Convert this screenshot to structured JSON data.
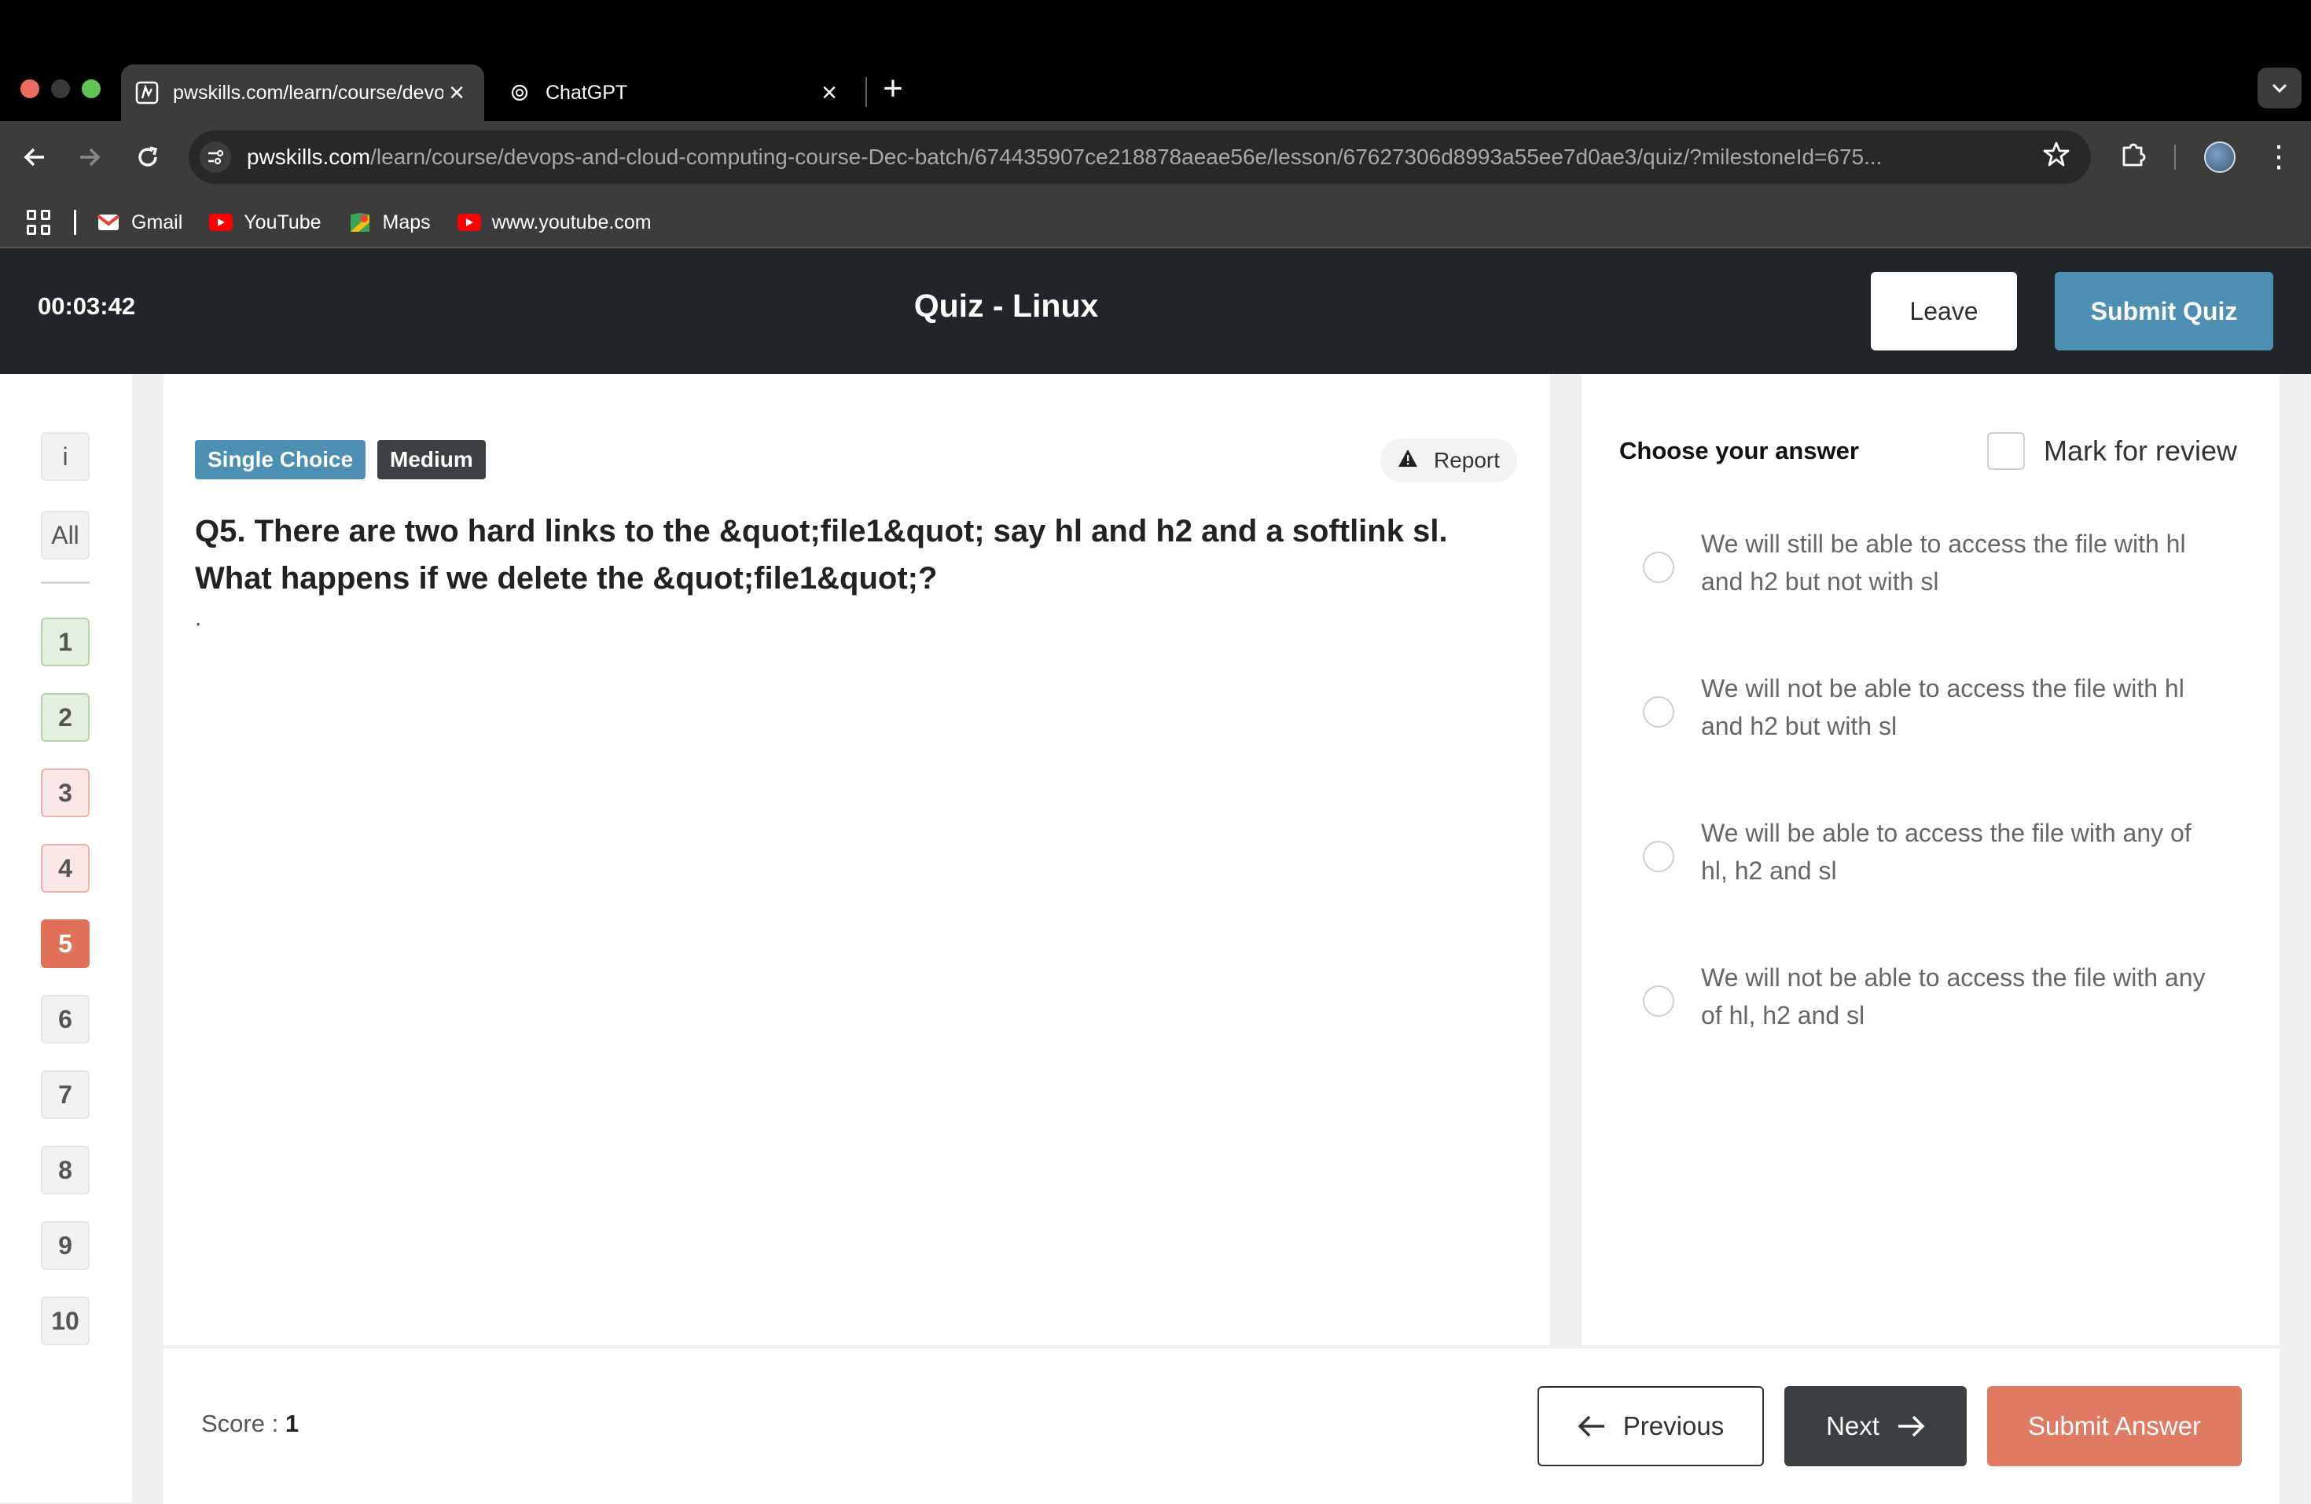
{
  "browser": {
    "tabs": [
      {
        "title": "pwskills.com/learn/course/devops-and-cloud",
        "active": true
      },
      {
        "title": "ChatGPT",
        "active": false
      }
    ],
    "url_host": "pwskills.com",
    "url_path": "/learn/course/devops-and-cloud-computing-course-Dec-batch/674435907ce218878aeae56e/lesson/67627306d8993a55ee7d0ae3/quiz/?milestoneId=675...",
    "bookmarks": [
      {
        "label": "Gmail",
        "icon": "gmail-icon"
      },
      {
        "label": "YouTube",
        "icon": "youtube-icon"
      },
      {
        "label": "Maps",
        "icon": "maps-icon"
      },
      {
        "label": "www.youtube.com",
        "icon": "youtube-icon"
      }
    ]
  },
  "header": {
    "timer": "00:03:42",
    "title": "Quiz - Linux",
    "leave_label": "Leave",
    "submit_quiz_label": "Submit Quiz"
  },
  "sidebar": {
    "info_label": "i",
    "all_label": "All",
    "questions": [
      "1",
      "2",
      "3",
      "4",
      "5",
      "6",
      "7",
      "8",
      "9",
      "10"
    ]
  },
  "question": {
    "type_badge": "Single Choice",
    "difficulty_badge": "Medium",
    "report_label": "Report",
    "text": "Q5. There are two hard links to the &quot;file1&quot; say hl and h2 and a softlink sl. What happens if we delete the &quot;file1&quot;?",
    "trailing": "."
  },
  "answers": {
    "heading": "Choose your answer",
    "mark_for_review_label": "Mark for review",
    "options": [
      "We will still be able to access the file with hl and h2 but not with sl",
      "We will not be able to access the file with hl and h2 but with sl",
      "We will be able to access the file with any of hl, h2 and sl",
      "We will not be able to access the file with any of hl, h2 and sl"
    ]
  },
  "footer": {
    "score_label": "Score : ",
    "score_value": "1",
    "previous_label": "Previous",
    "next_label": "Next",
    "submit_answer_label": "Submit Answer"
  },
  "colors": {
    "header_bg": "#202528",
    "accent_blue": "#4d8fb3",
    "current_question": "#e07058",
    "submit_answer": "#e07a63"
  }
}
